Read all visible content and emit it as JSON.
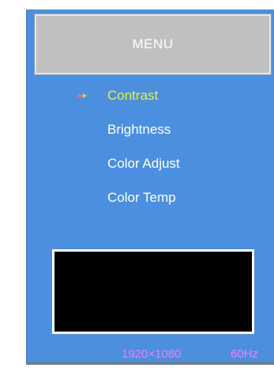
{
  "osd": {
    "header_label": "MENU",
    "items": [
      {
        "label": "Contrast",
        "selected": true
      },
      {
        "label": "Brightness",
        "selected": false
      },
      {
        "label": "Color  Adjust",
        "selected": false
      },
      {
        "label": "Color  Temp",
        "selected": false
      }
    ],
    "selector_icon": "arrow-right-icon",
    "status": {
      "resolution": "1920×1080",
      "refresh_rate": "60Hz"
    }
  },
  "colors": {
    "panel_background": "#4b8fe0",
    "header_background": "#c0c0c0",
    "selected_text": "#e5f04a",
    "normal_text": "#ffffff",
    "status_text": "#f080f0",
    "preview_background": "#000000"
  }
}
